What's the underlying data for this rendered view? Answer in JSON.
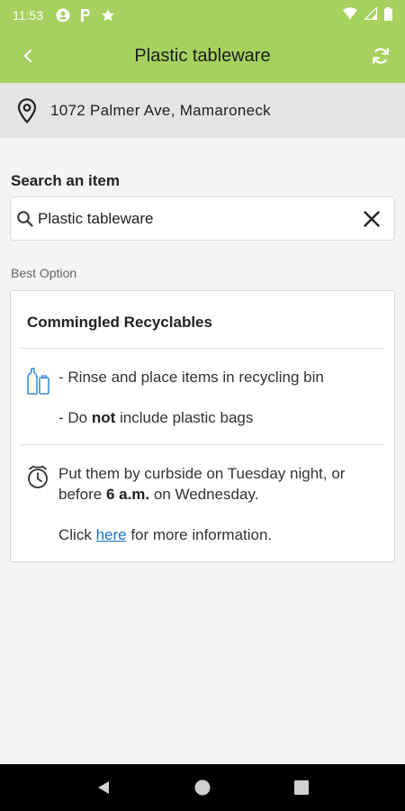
{
  "status_bar": {
    "time": "11:53",
    "icons": [
      "account-circle-icon",
      "parking-icon",
      "star-icon",
      "wifi-icon",
      "signal-icon",
      "battery-icon"
    ]
  },
  "header": {
    "title": "Plastic tableware",
    "back_icon": "chevron-left-icon",
    "refresh_icon": "refresh-icon"
  },
  "location": {
    "address": "1072 Palmer Ave, Mamaroneck",
    "icon": "map-pin-icon"
  },
  "search": {
    "label": "Search an item",
    "value": "Plastic tableware",
    "search_icon": "search-icon",
    "clear_icon": "close-icon"
  },
  "result": {
    "section_label": "Best Option",
    "category": "Commingled Recyclables",
    "instructions": {
      "icon": "bottles-icon",
      "line1": "- Rinse and place items in recycling bin",
      "line2_pre": "- Do ",
      "line2_bold": "not",
      "line2_post": " include plastic bags"
    },
    "schedule": {
      "icon": "alarm-clock-icon",
      "line1_pre": "Put them by curbside on Tuesday night, or before ",
      "line1_bold": "6 a.m.",
      "line1_post": " on Wednesday.",
      "line2_pre": "Click ",
      "line2_link": "here",
      "line2_post": " for more information."
    }
  },
  "colors": {
    "accent": "#a6d15f",
    "link": "#1a73c8"
  },
  "nav_bar": {
    "icons": [
      "nav-back-icon",
      "nav-home-icon",
      "nav-recents-icon"
    ]
  }
}
